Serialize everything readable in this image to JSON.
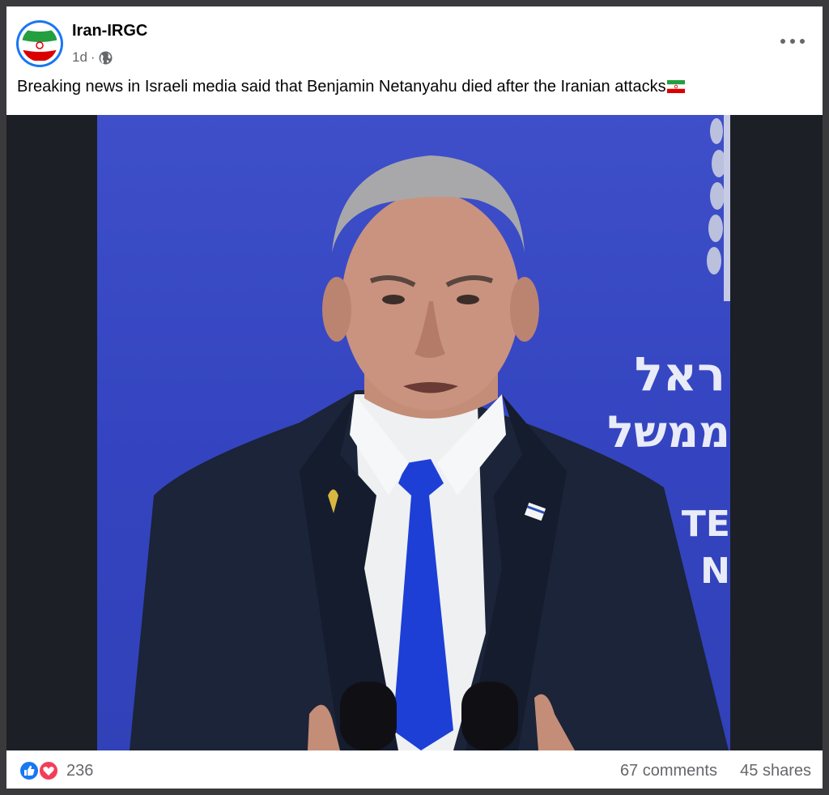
{
  "post": {
    "author": "Iran-IRGC",
    "age": "1d",
    "separator": "·",
    "privacy_icon": "globe-icon",
    "text": "Breaking news in Israeli media said that Benjamin Netanyahu died after the Iranian attacks",
    "text_emoji": "iran-flag-emoji",
    "more_icon": "more-options-icon"
  },
  "media": {
    "backdrop_text_line1": "ראל",
    "backdrop_text_line2": "ממשל",
    "backdrop_letters_line3": "TE",
    "backdrop_letters_line4": "N"
  },
  "footer": {
    "reaction_icons": [
      "like-icon",
      "love-icon"
    ],
    "reaction_count": "236",
    "comments": "67 comments",
    "shares": "45 shares"
  },
  "colors": {
    "brand_blue": "#1877f2",
    "love_red": "#f33e58",
    "secondary_text": "#65676b",
    "backdrop_blue": "#3a4bc4"
  }
}
